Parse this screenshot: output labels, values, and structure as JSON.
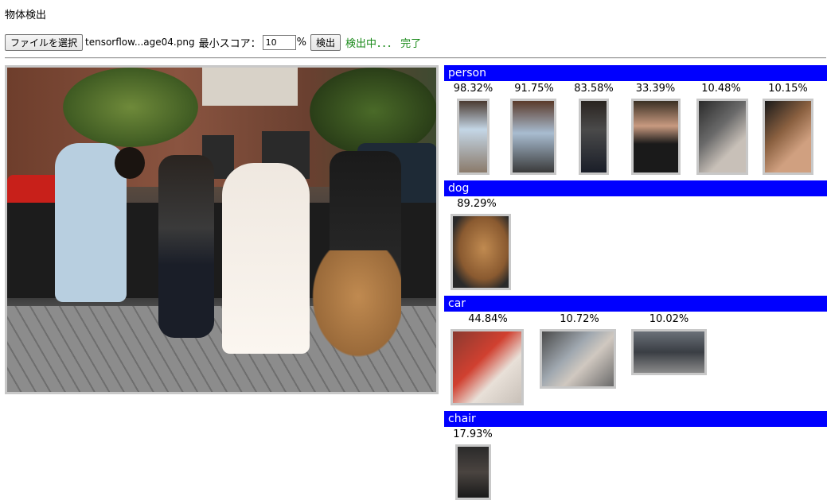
{
  "page": {
    "title": "物体検出"
  },
  "toolbar": {
    "file_button": "ファイルを選択",
    "file_name": "tensorflow...age04.png",
    "min_score_label": "最小スコア：",
    "min_score_value": "10",
    "percent": "%",
    "detect_button": "検出",
    "status": "検出中．．． 完了"
  },
  "results": [
    {
      "label": "person",
      "detections": [
        {
          "score": "98.32%"
        },
        {
          "score": "91.75%"
        },
        {
          "score": "83.58%"
        },
        {
          "score": "33.39%"
        },
        {
          "score": "10.48%"
        },
        {
          "score": "10.15%"
        }
      ]
    },
    {
      "label": "dog",
      "detections": [
        {
          "score": "89.29%"
        }
      ]
    },
    {
      "label": "car",
      "detections": [
        {
          "score": "44.84%"
        },
        {
          "score": "10.72%"
        },
        {
          "score": "10.02%"
        }
      ]
    },
    {
      "label": "chair",
      "detections": [
        {
          "score": "17.93%"
        }
      ]
    }
  ]
}
